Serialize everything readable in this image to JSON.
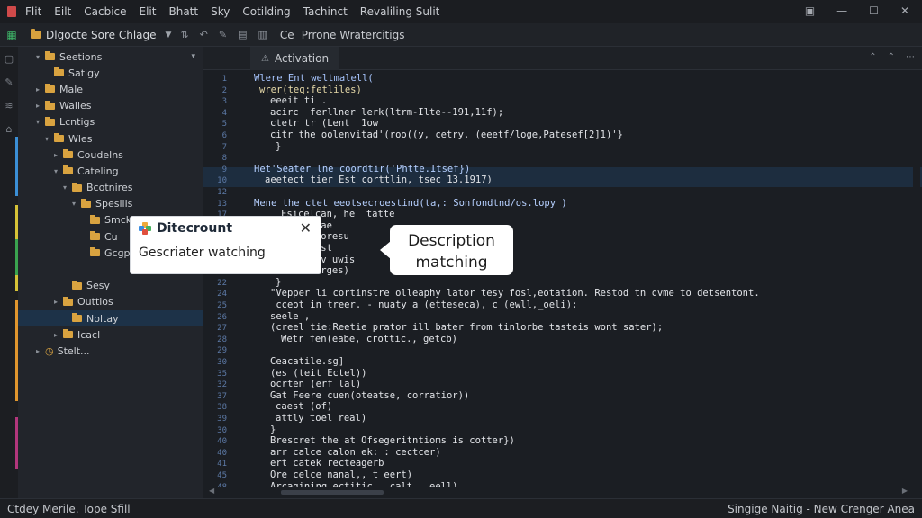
{
  "menu": [
    "Flit",
    "Eilt",
    "Cacbice",
    "Elit",
    "Bhatt",
    "Sky",
    "Cotilding",
    "Tachinct",
    "Revaliling Sulit"
  ],
  "window_controls": [
    "▣",
    "—",
    "☐",
    "✕"
  ],
  "toolbar": {
    "project": "Dlgocte Sore Chlage",
    "scope_label": "Ce",
    "scope_text": "Prrone Wratercitigs"
  },
  "sidebar": {
    "items": [
      {
        "label": "Seetions",
        "depth": 0,
        "arrow": "▾",
        "folder": true
      },
      {
        "label": "Satigy",
        "depth": 1,
        "arrow": "",
        "folder": true
      },
      {
        "label": "Male",
        "depth": 0,
        "arrow": "▸",
        "folder": true
      },
      {
        "label": "Wailes",
        "depth": 0,
        "arrow": "▸",
        "folder": true
      },
      {
        "label": "Lcntigs",
        "depth": 0,
        "arrow": "▾",
        "folder": true
      },
      {
        "label": "Wles",
        "depth": 1,
        "arrow": "▾",
        "folder": true
      },
      {
        "label": "Coudelns",
        "depth": 2,
        "arrow": "▸",
        "folder": true
      },
      {
        "label": "Cateling",
        "depth": 2,
        "arrow": "▾",
        "folder": true
      },
      {
        "label": "Bcotnires",
        "depth": 3,
        "arrow": "▾",
        "folder": true
      },
      {
        "label": "Spesilis",
        "depth": 4,
        "arrow": "▾",
        "folder": true
      },
      {
        "label": "Smcks",
        "depth": 5,
        "arrow": "",
        "folder": true
      },
      {
        "label": "Cu",
        "depth": 5,
        "arrow": "",
        "folder": true
      },
      {
        "label": "Gcgpt",
        "depth": 5,
        "arrow": "",
        "folder": true
      },
      {
        "label": "",
        "depth": 0,
        "arrow": "",
        "folder": false
      },
      {
        "label": "Sesy",
        "depth": 3,
        "arrow": "",
        "folder": true
      },
      {
        "label": "Outtios",
        "depth": 2,
        "arrow": "▸",
        "folder": true
      },
      {
        "label": "Noltay",
        "depth": 3,
        "arrow": "",
        "folder": true,
        "selected": true
      },
      {
        "label": "Icacl",
        "depth": 2,
        "arrow": "▸",
        "folder": true
      },
      {
        "label": "Stelt...",
        "depth": 0,
        "arrow": "▸",
        "folder": false
      }
    ]
  },
  "tab": {
    "label": "Activation"
  },
  "editor": {
    "line_numbers": [
      "1",
      "2",
      "3",
      "4",
      "5",
      "6",
      "7",
      "8",
      "9",
      "10",
      "12",
      "13",
      "17",
      "19",
      "12",
      "15",
      "14",
      "17",
      "22",
      "24",
      "25",
      "26",
      "27",
      "28",
      "29",
      "30",
      "35",
      "32",
      "37",
      "38",
      "39",
      "30",
      "40",
      "40",
      "41",
      "45",
      "48",
      "41",
      "42",
      "43",
      "47",
      "41",
      "47",
      "43",
      "42",
      "45",
      "48",
      "42"
    ],
    "lines": [
      {
        "indent": 0,
        "text": "Wlere Ent weltmalell(",
        "color": "#a8c6ff"
      },
      {
        "indent": 1,
        "text": "wrer(teq:fetliles)",
        "color": "#e6d9a8"
      },
      {
        "indent": 3,
        "text": "eeeit ti .",
        "color": "#d7dade"
      },
      {
        "indent": 3,
        "text": "acirc  ferllner lerk(ltrm-Ilte--191,11f);",
        "color": "#e2e4e8"
      },
      {
        "indent": 3,
        "text": "ctetr tr (Lent  1ow",
        "color": "#e2e4e8"
      },
      {
        "indent": 3,
        "text": "citr the oolenvitad'(roo((y, cetry. (eeetf/loge,Patesef[2]1)'}",
        "color": "#e2e4e8"
      },
      {
        "indent": 4,
        "text": "}",
        "color": "#e2e4e8"
      },
      {
        "indent": 0,
        "text": "",
        "color": "#e2e4e8"
      },
      {
        "indent": 0,
        "text": "Het'Seater lne coordtir('Phtte.Itsef})",
        "color": "#b6d0ff"
      },
      {
        "indent": 2,
        "text": "aeetect tier Est corttlin, tsec 13.1917)",
        "color": "#e2e4e8"
      },
      {
        "indent": 0,
        "text": "",
        "color": "#e2e4e8"
      },
      {
        "indent": 0,
        "text": "Mene the ctet eeotsecroestind(ta,: Sonfondtnd/os.lopy )",
        "color": "#b6d0ff"
      },
      {
        "indent": 5,
        "text": "Fsicelcan, he  tatte",
        "color": "#e2e4e8"
      },
      {
        "indent": 5,
        "text": "Forecivae",
        "color": "#e2e4e8"
      },
      {
        "indent": 5,
        "text": "Dece Deoresu                   ,Fcal);",
        "color": "#e2e4e8"
      },
      {
        "indent": 5,
        "text": "ant teast                     Lell",
        "color": "#e2e4e8"
      },
      {
        "indent": 5,
        "text": "recal(lv uwis",
        "color": "#e2e4e8"
      },
      {
        "indent": 5,
        "text": "etc ecerges)",
        "color": "#e2e4e8"
      },
      {
        "indent": 4,
        "text": "}",
        "color": "#e2e4e8"
      },
      {
        "indent": 3,
        "text": "\"Vepper li cortinstre olleaphy lator tesy fosl,eotation. Restod tn cvme to detsentont.",
        "color": "#e2e4e8"
      },
      {
        "indent": 3,
        "text": " cceot in treer. - nuaty a (etteseca), c (ewll,_oeli);",
        "color": "#e2e4e8"
      },
      {
        "indent": 3,
        "text": "seele ,",
        "color": "#e2e4e8"
      },
      {
        "indent": 3,
        "text": "(creel tie:Reetie prator ill bater from tinlorbe tasteis wont sater);",
        "color": "#e2e4e8"
      },
      {
        "indent": 5,
        "text": "Wetr fen(eabe, crottic., getcb)",
        "color": "#e2e4e8"
      },
      {
        "indent": 0,
        "text": "",
        "color": "#e2e4e8"
      },
      {
        "indent": 3,
        "text": "Ceacatile.sg]",
        "color": "#e2e4e8"
      },
      {
        "indent": 3,
        "text": "(es (teit Ectel))",
        "color": "#e2e4e8"
      },
      {
        "indent": 3,
        "text": "ocrten (erf lal)",
        "color": "#e2e4e8"
      },
      {
        "indent": 3,
        "text": "Gat Feere cuen(oteatse, corratior))",
        "color": "#e2e4e8"
      },
      {
        "indent": 4,
        "text": "caest (of)",
        "color": "#e2e4e8"
      },
      {
        "indent": 4,
        "text": "attly toel real)",
        "color": "#e2e4e8"
      },
      {
        "indent": 3,
        "text": "}",
        "color": "#e2e4e8"
      },
      {
        "indent": 3,
        "text": "Brescret the at Ofsegeritntioms is cotter})",
        "color": "#e2e4e8"
      },
      {
        "indent": 3,
        "text": "arr calce calon ek: : cectcer)",
        "color": "#e2e4e8"
      },
      {
        "indent": 3,
        "text": "ert catek recteagerb",
        "color": "#e2e4e8"
      },
      {
        "indent": 3,
        "text": "Ore celce nanal,, t eert)",
        "color": "#e2e4e8"
      },
      {
        "indent": 3,
        "text": "Arcagining ectitic., calt,  eell)",
        "color": "#e2e4e8"
      }
    ]
  },
  "popup": {
    "title": "Ditecrount",
    "text": "Gescriater watching",
    "close": "✕"
  },
  "callout": {
    "line1": "Description",
    "line2": "matching"
  },
  "statusbar": {
    "left": "Ctdey Merile. Tope Sfill",
    "right": "Singige Naitig - New Crenger Anea"
  },
  "colors": {
    "accent": "#1d3248",
    "folder": "#d9a340",
    "editor_bg": "#1b1e23"
  }
}
